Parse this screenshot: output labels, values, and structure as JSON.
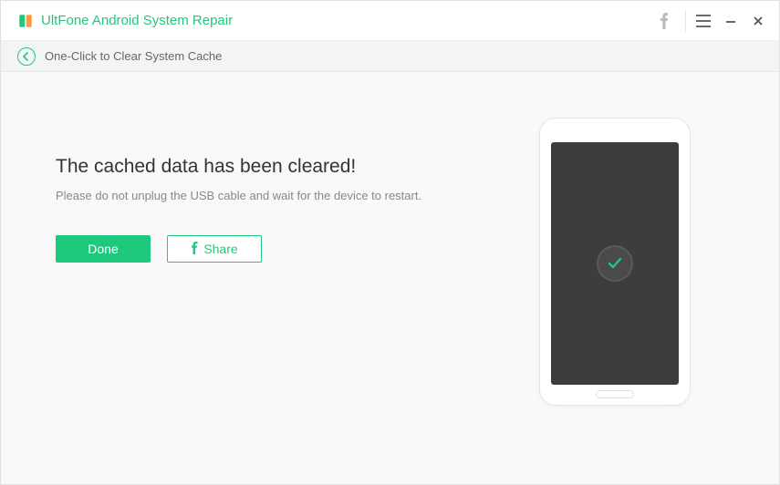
{
  "app": {
    "title": "UltFone Android System Repair"
  },
  "breadcrumb": {
    "text": "One-Click to Clear System Cache"
  },
  "main": {
    "heading": "The cached data has been cleared!",
    "subtext": "Please do not unplug the USB cable and wait for the device to restart.",
    "done_label": "Done",
    "share_label": "Share"
  },
  "colors": {
    "accent": "#1ec97e"
  }
}
